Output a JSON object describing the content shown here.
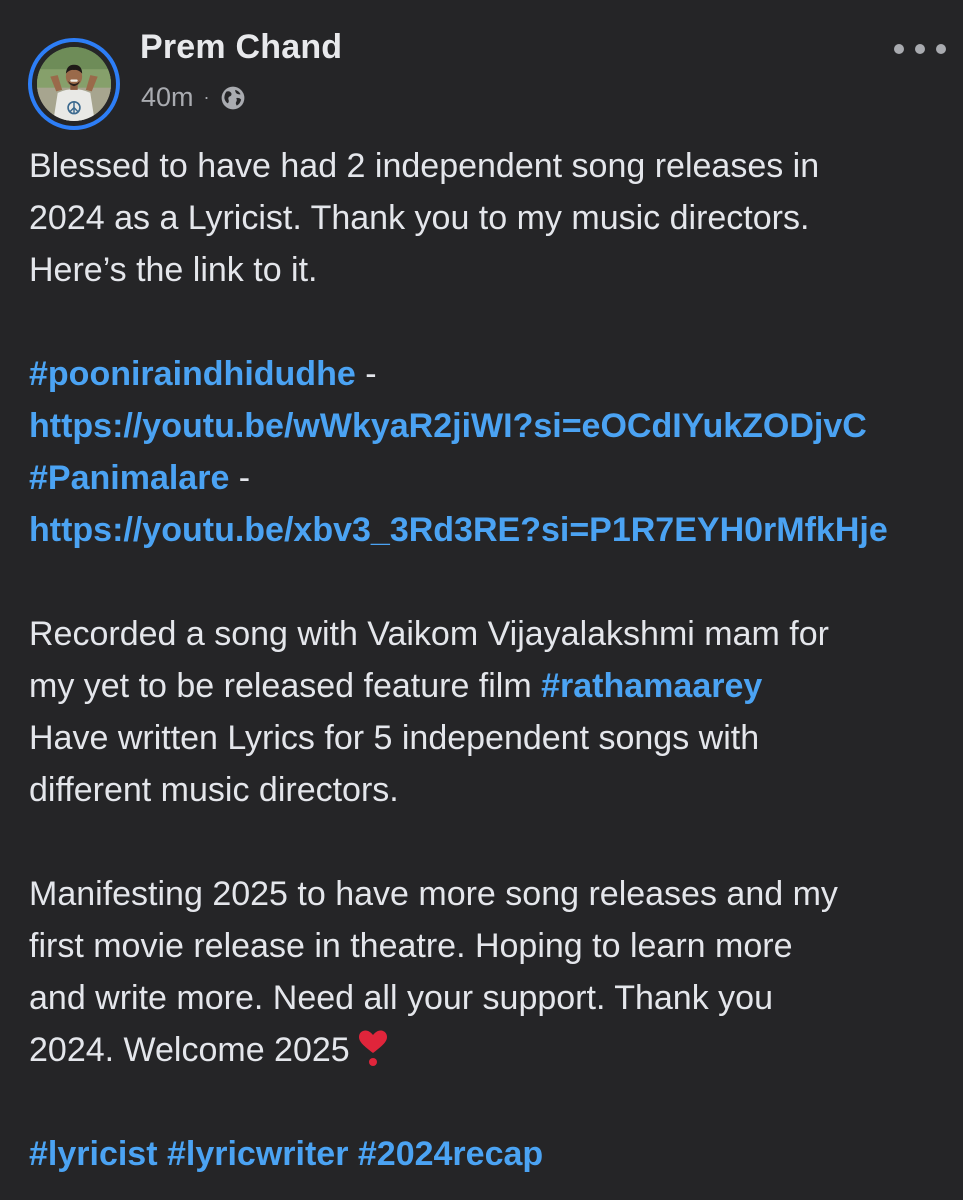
{
  "post": {
    "author": "Prem Chand",
    "time": "40m",
    "separator": "·",
    "privacy_icon": "globe-icon",
    "more_icon": "more-horizontal-icon",
    "accent_color": "#2d7ef7",
    "link_color": "#4ba3f3",
    "paragraph1": [
      "Blessed to have had 2 independent song releases in",
      "2024 as a Lyricist. Thank you to my music directors.",
      "Here’s the link to it."
    ],
    "links": [
      {
        "hashtag": "#pooniraindhidudhe",
        "dash": " -",
        "url": "https://youtu.be/wWkyaR2jiWI?si=eOCdIYukZODjvC"
      },
      {
        "hashtag": "#Panimalare",
        "dash": " -",
        "url": "https://youtu.be/xbv3_3Rd3RE?si=P1R7EYH0rMfkHje"
      }
    ],
    "paragraph2": {
      "line1": "Recorded a song with Vaikom Vijayalakshmi mam for",
      "line2_text": "my yet to be released feature film ",
      "line2_hashtag": "#rathamaarey",
      "line3": "Have written Lyrics for 5 independent songs with",
      "line4": "different music directors."
    },
    "paragraph3": {
      "line1": "Manifesting 2025 to have more song releases and my",
      "line2": "first movie release in theatre. Hoping to learn more",
      "line3": "and write more. Need all your support. Thank you",
      "line4": "2024. Welcome 2025",
      "emoji_icon": "heart-exclamation-icon"
    },
    "hashtags": [
      "#lyricist",
      "#lyricwriter",
      "#2024recap"
    ]
  }
}
